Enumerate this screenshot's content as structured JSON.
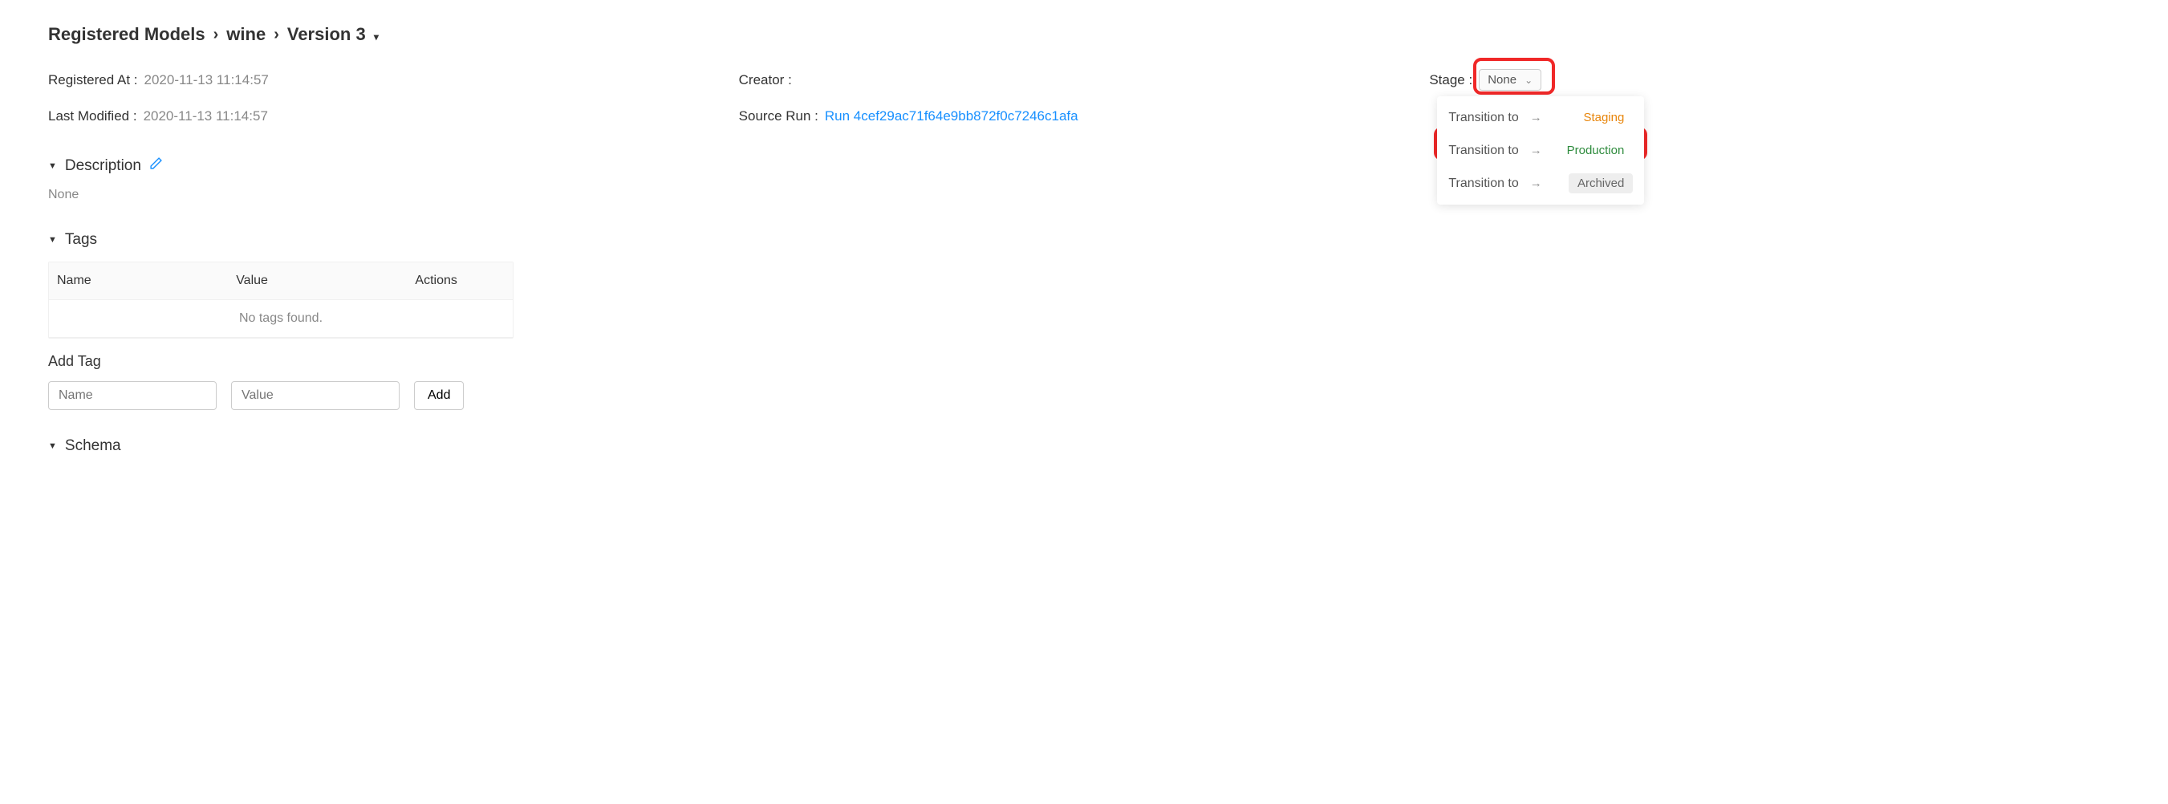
{
  "breadcrumb": {
    "root": "Registered Models",
    "model": "wine",
    "version": "Version 3"
  },
  "meta": {
    "registered_at_label": "Registered At :",
    "registered_at_value": "2020-11-13 11:14:57",
    "creator_label": "Creator :",
    "creator_value": "",
    "stage_label": "Stage :",
    "stage_value": "None",
    "last_modified_label": "Last Modified :",
    "last_modified_value": "2020-11-13 11:14:57",
    "source_run_label": "Source Run :",
    "source_run_link": "Run 4cef29ac71f64e9bb872f0c7246c1afa"
  },
  "dropdown": {
    "transition_label": "Transition to",
    "staging": "Staging",
    "production": "Production",
    "archived": "Archived"
  },
  "sections": {
    "description_title": "Description",
    "description_value": "None",
    "tags_title": "Tags",
    "schema_title": "Schema"
  },
  "tags_table": {
    "col_name": "Name",
    "col_value": "Value",
    "col_actions": "Actions",
    "empty": "No tags found."
  },
  "add_tag": {
    "title": "Add Tag",
    "name_placeholder": "Name",
    "value_placeholder": "Value",
    "button": "Add"
  }
}
